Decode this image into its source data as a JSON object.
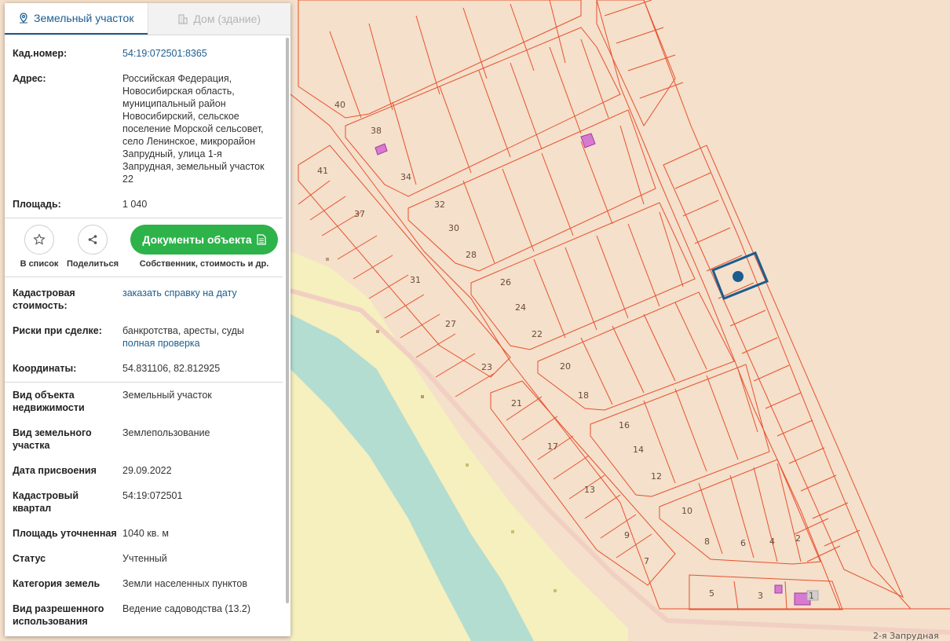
{
  "tabs": [
    {
      "label": "Земельный участок",
      "active": true,
      "icon": "map-pin-icon"
    },
    {
      "label": "Дом (здание)",
      "active": false,
      "icon": "building-icon"
    }
  ],
  "details": {
    "kadnomer_label": "Кад.номер:",
    "kadnomer_value": "54:19:072501:8365",
    "address_label": "Адрес:",
    "address_value": "Российская Федерация, Новосибирская область, муниципальный район Новосибирский, сельское поселение Морской сельсовет, село Ленинское, микрорайон Запрудный, улица 1-я Запрудная, земельный участок 22",
    "area_label": "Площадь:",
    "area_value": "1 040"
  },
  "actions": {
    "favorite_label": "В список",
    "share_label": "Поделиться",
    "documents_button": "Документы объекта",
    "documents_sub": "Собственник, стоимость и др."
  },
  "info": {
    "cost_label": "Кадастровая стоимость:",
    "cost_link": "заказать справку на дату",
    "risks_label": "Риски при сделке:",
    "risks_value": "банкротства, аресты, суды",
    "risks_link": "полная проверка",
    "coords_label": "Координаты:",
    "coords_value": "54.831106, 82.812925"
  },
  "attributes": [
    {
      "label": "Вид объекта недвижимости",
      "value": "Земельный участок"
    },
    {
      "label": "Вид земельного участка",
      "value": "Землепользование"
    },
    {
      "label": "Дата присвоения",
      "value": "29.09.2022"
    },
    {
      "label": "Кадастровый квартал",
      "value": "54:19:072501"
    },
    {
      "label": "Площадь уточненная",
      "value": "1040 кв. м"
    },
    {
      "label": "Статус",
      "value": "Учтенный"
    },
    {
      "label": "Категория земель",
      "value": "Земли населенных пунктов"
    },
    {
      "label": "Вид разрешенного использования",
      "value": "Ведение садоводства (13.2)"
    }
  ],
  "map": {
    "road_label": "2-я Запрудная",
    "plot_numbers": [
      "40",
      "38",
      "34",
      "41",
      "37",
      "32",
      "30",
      "28",
      "31",
      "26",
      "24",
      "22",
      "27",
      "23",
      "20",
      "18",
      "21",
      "16",
      "14",
      "12",
      "17",
      "13",
      "10",
      "8",
      "6",
      "4",
      "2",
      "9",
      "7",
      "5",
      "3",
      "1"
    ],
    "colors": {
      "parcel_line": "#e8502e",
      "land_fill": "#f4e0cb",
      "water": "#b3ddd1",
      "floodplain": "#f6efbe",
      "selection": "#1c5d8f",
      "building": "#d77ad0",
      "docs_button": "#2db34a",
      "link": "#1c5d8f"
    }
  }
}
